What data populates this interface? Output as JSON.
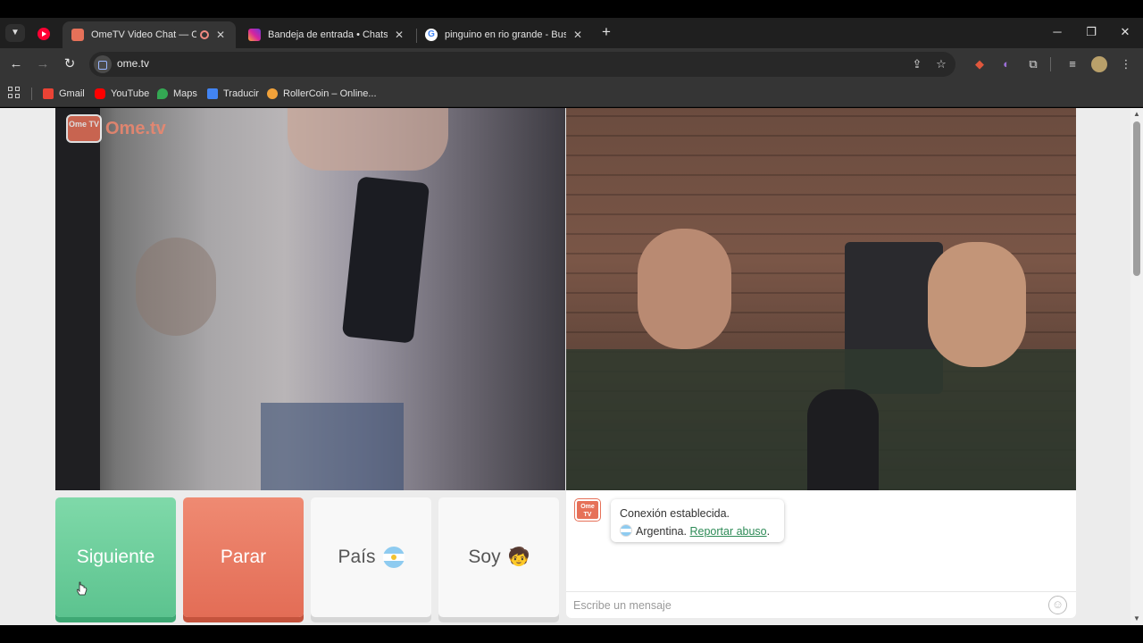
{
  "browser": {
    "tabs": [
      {
        "title": "OmeTV Video Chat — Ome",
        "favicon_color": "#e67159",
        "active": true
      },
      {
        "title": "Bandeja de entrada • Chats",
        "favicon_color": "#d6249f",
        "active": false
      },
      {
        "title": "pinguino en rio grande - Buscar",
        "favicon_color": "#4285f4",
        "active": false
      }
    ],
    "url": "ome.tv",
    "bookmarks": [
      {
        "label": "Gmail",
        "icon_color": "#ea4335"
      },
      {
        "label": "YouTube",
        "icon_color": "#ff0000"
      },
      {
        "label": "Maps",
        "icon_color": "#34a853"
      },
      {
        "label": "Traducir",
        "icon_color": "#4285f4"
      },
      {
        "label": "RollerCoin – Online...",
        "icon_color": "#f2a23a"
      }
    ]
  },
  "page": {
    "logo": {
      "badge": "Ome TV",
      "text": "Ome.tv"
    },
    "buttons": {
      "next": "Siguiente",
      "stop": "Parar",
      "country": "País",
      "me": "Soy"
    },
    "chat": {
      "logo_badge": "Ome TV",
      "status": "Conexión establecida.",
      "country": "Argentina.",
      "report_link": "Reportar abuso",
      "report_suffix": ".",
      "input_placeholder": "Escribe un mensaje"
    }
  },
  "colors": {
    "next_button": "#5cc38f",
    "stop_button": "#e36d56",
    "link": "#2e8b57",
    "brand": "#e67159"
  }
}
